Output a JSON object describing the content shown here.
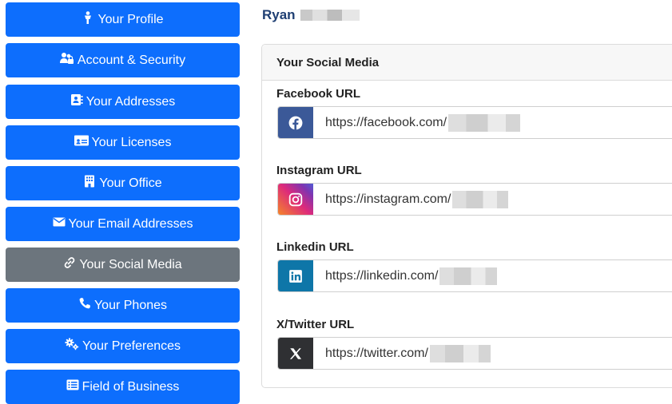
{
  "sidebar": {
    "items": [
      {
        "label": "Your Profile",
        "icon": "person-icon"
      },
      {
        "label": "Account & Security",
        "icon": "users-lock-icon"
      },
      {
        "label": "Your Addresses",
        "icon": "address-book-icon"
      },
      {
        "label": "Your Licenses",
        "icon": "id-card-icon"
      },
      {
        "label": "Your Office",
        "icon": "building-icon"
      },
      {
        "label": "Your Email Addresses",
        "icon": "envelope-icon"
      },
      {
        "label": "Your Social Media",
        "icon": "link-icon",
        "active": true
      },
      {
        "label": "Your Phones",
        "icon": "phone-icon"
      },
      {
        "label": "Your Preferences",
        "icon": "gears-icon"
      },
      {
        "label": "Field of Business",
        "icon": "list-icon"
      }
    ],
    "colors": {
      "primary": "#0d6efd",
      "active": "#6c757d"
    }
  },
  "user": {
    "first_name": "Ryan"
  },
  "social_card": {
    "title": "Your Social Media",
    "fields": [
      {
        "label": "Facebook URL",
        "value": "https://facebook.com/",
        "icon": "facebook-icon",
        "color": "#3b5998"
      },
      {
        "label": "Instagram URL",
        "value": "https://instagram.com/",
        "icon": "instagram-icon",
        "color": "#dd2a7b"
      },
      {
        "label": "Linkedin URL",
        "value": "https://linkedin.com/",
        "icon": "linkedin-icon",
        "color": "#0e76a8"
      },
      {
        "label": "X/Twitter URL",
        "value": "https://twitter.com/",
        "icon": "x-twitter-icon",
        "color": "#2f3033"
      }
    ]
  }
}
